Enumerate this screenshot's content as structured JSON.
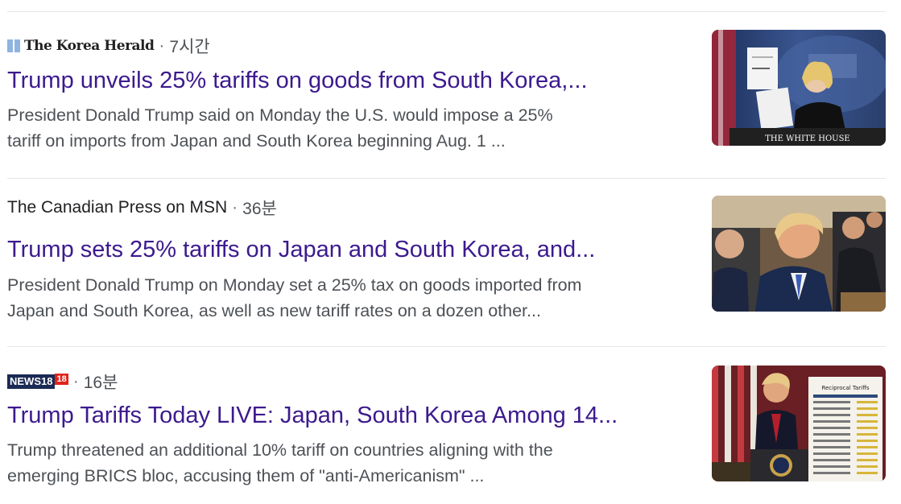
{
  "results": [
    {
      "source": "The Korea Herald",
      "time": "7시간",
      "title": "Trump unveils 25% tariffs on goods from South Korea,...",
      "snippet_line1": "President Donald Trump said on Monday the U.S. would impose a 25%",
      "snippet_line2": "tariff on imports from Japan and South Korea beginning Aug. 1 ...",
      "thumbnail_caption": "THE WHITE HOUSE"
    },
    {
      "source": "The Canadian Press on MSN",
      "time": "36분",
      "title": "Trump sets 25% tariffs on Japan and South Korea, and...",
      "snippet_line1": "President Donald Trump on Monday set a 25% tax on goods imported from",
      "snippet_line2": "Japan and South Korea, as well as new tariff rates on a dozen other...",
      "thumbnail_caption": ""
    },
    {
      "source": "NEWS18",
      "source_logo_num": "18",
      "time": "16분",
      "title": "Trump Tariffs Today LIVE: Japan, South Korea Among 14...",
      "snippet_line1": "Trump threatened an additional 10% tariff on countries aligning with the",
      "snippet_line2": "emerging BRICS bloc, accusing them of \"anti-Americanism\" ...",
      "thumbnail_caption": "Reciprocal Tariffs"
    }
  ],
  "separator": "·",
  "colors": {
    "title_link": "#3c1a8e",
    "snippet": "#4d5156",
    "divider": "#e6e6e6"
  },
  "icons": [
    "korea-herald-logo",
    "news18-logo"
  ]
}
